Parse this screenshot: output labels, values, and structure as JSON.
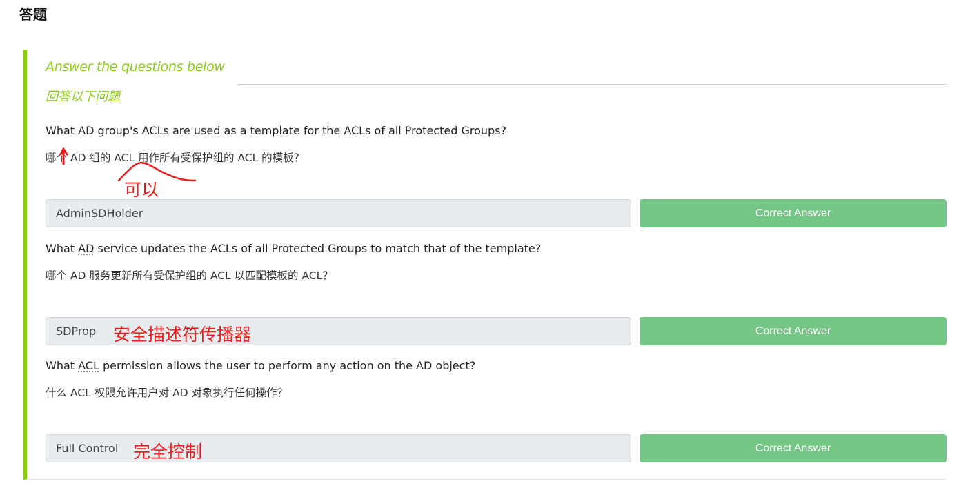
{
  "heading": "答题",
  "task": {
    "title": "Answer the questions below",
    "title_cn": "回答以下问题",
    "questions": [
      {
        "text_parts": [
          "What AD group's ACLs are used as a template for the ACLs of all Protected Groups?"
        ],
        "text_cn": "哪个 AD 组的 ACL 用作所有受保护组的 ACL 的模板？",
        "answer": "AdminSDHolder",
        "button": "Correct Answer",
        "note": "可以"
      },
      {
        "text_parts": [
          "What ",
          "AD",
          " service updates the ACLs of all Protected Groups to match that of the template?"
        ],
        "text_cn": "哪个 AD 服务更新所有受保护组的 ACL 以匹配模板的 ACL？",
        "answer": "SDProp",
        "button": "Correct Answer",
        "note": "安全描述符传播器"
      },
      {
        "text_parts": [
          "What ",
          "ACL",
          " permission allows the user to perform any action on the AD object?"
        ],
        "text_cn": "什么 ACL 权限允许用户对 AD 对象执行任何操作？",
        "answer": "Full Control",
        "button": "Correct Answer",
        "note": "完全控制"
      }
    ]
  },
  "colors": {
    "accent": "#88cc14",
    "correct_button": "#75c786",
    "annotation": "#ee1c1c"
  }
}
